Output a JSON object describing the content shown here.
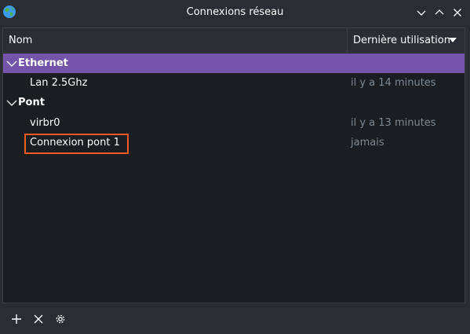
{
  "window": {
    "title": "Connexions réseau",
    "controls": [
      "chevron-down-icon",
      "chevron-up-icon",
      "close-icon"
    ]
  },
  "table": {
    "columns": {
      "name": "Nom",
      "last_used": "Dernière utilisation"
    },
    "groups": [
      {
        "name": "Ethernet",
        "selected": true,
        "connections": [
          {
            "name": "Lan 2.5Ghz",
            "last_used": "il y a 14 minutes"
          }
        ]
      },
      {
        "name": "Pont",
        "selected": false,
        "connections": [
          {
            "name": "virbr0",
            "last_used": "il y a 13 minutes"
          },
          {
            "name": "Connexion pont 1",
            "last_used": "jamais"
          }
        ]
      }
    ]
  },
  "footer": {
    "buttons": [
      "add-icon",
      "delete-icon",
      "settings-icon"
    ]
  },
  "colors": {
    "selection": "#7354a8",
    "highlight_box": "#f05a22",
    "dim_text": "#7b8893"
  }
}
